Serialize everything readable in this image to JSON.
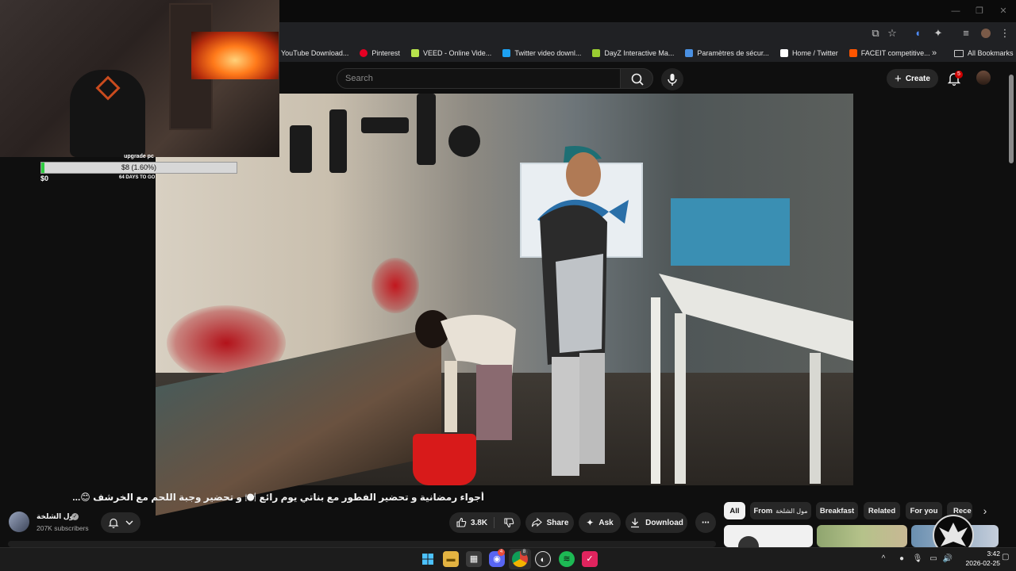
{
  "browser": {
    "window_controls": [
      "—",
      "❐",
      "✕"
    ],
    "icons": [
      "cast-icon",
      "star-icon",
      "extension-icon",
      "puzzle-icon",
      "tab-search-icon",
      "profile-icon",
      "menu-icon"
    ],
    "bookmarks": [
      {
        "label": "YouTube Download...",
        "color": "#cc0000"
      },
      {
        "label": "Pinterest",
        "color": "#e60023"
      },
      {
        "label": "VEED - Online Vide...",
        "color": "#b7e34c"
      },
      {
        "label": "Twitter video downl...",
        "color": "#1da1f2"
      },
      {
        "label": "DayZ Interactive Ma...",
        "color": "#9acd32"
      },
      {
        "label": "Paramètres de sécur...",
        "color": "#4a90e2"
      },
      {
        "label": "Home / Twitter",
        "color": "#ffffff"
      },
      {
        "label": "FACEIT competitive...",
        "color": "#ff5500"
      }
    ],
    "more_label": "»",
    "all_bookmarks": "All Bookmarks"
  },
  "youtube": {
    "search_placeholder": "Search",
    "create_label": "Create",
    "notification_count": "5",
    "video": {
      "title": "أجواء رمضانية و تحضير الفطور مع بناتي يوم رائع 🍽️ و تحضير وجبة اللحم مع الخرشف 😊...",
      "channel_name": "مول الشلخة",
      "verified": "✓",
      "subscribers": "207K subscribers",
      "likes": "3.8K",
      "share_label": "Share",
      "ask_label": "Ask",
      "download_label": "Download",
      "more_label": "⋯"
    },
    "chips": [
      {
        "label": "All"
      },
      {
        "label": "From",
        "sub": "مول الشلخة"
      },
      {
        "label": "Breakfast"
      },
      {
        "label": "Related"
      },
      {
        "label": "For you"
      },
      {
        "label": "Rece"
      }
    ],
    "chip_next": "›"
  },
  "overlay": {
    "goal_title": "upgrade pc",
    "goal_progress": "$8 (1.60%)",
    "goal_fraction": 0.016,
    "goal_start": "$0",
    "goal_days": "64 DAYS TO GO"
  },
  "taskbar": {
    "apps": [
      "start",
      "file-explorer",
      "microsoft-store",
      "discord",
      "chrome",
      "steam",
      "spotify",
      "app"
    ],
    "discord_badge": "4",
    "chrome_badge": "8",
    "time": "3:42",
    "date": "2026-02-25",
    "tray_chevron": "^"
  },
  "colors": {
    "background": "#0f0f0f",
    "pill": "#272727",
    "notification": "#cc0000",
    "goal_fill": "#2ecc40"
  }
}
